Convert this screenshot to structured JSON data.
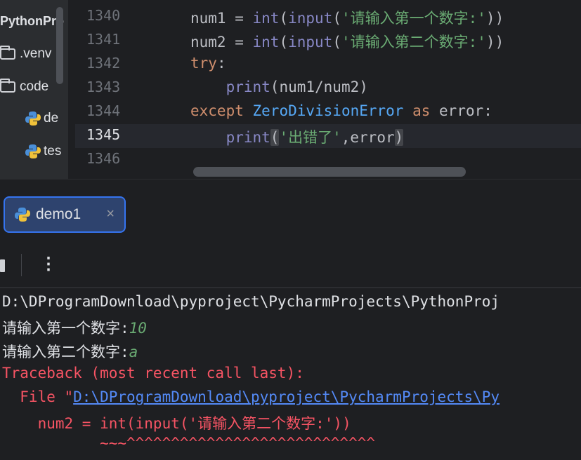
{
  "project": {
    "title": "PythonPro",
    "items": [
      {
        "label": ".venv",
        "icon": "folder-icon"
      },
      {
        "label": "code",
        "icon": "folder-icon"
      },
      {
        "label": "de",
        "icon": "python-file-icon"
      },
      {
        "label": "tes",
        "icon": "python-file-icon"
      }
    ]
  },
  "editor": {
    "line_numbers": [
      "1340",
      "1341",
      "1342",
      "1343",
      "1344",
      "1345",
      "1346"
    ],
    "current_line": "1345",
    "lines": [
      {
        "parts": [
          {
            "t": "num1 = ",
            "c": ""
          },
          {
            "t": "int",
            "c": "bi"
          },
          {
            "t": "(",
            "c": ""
          },
          {
            "t": "input",
            "c": "bi"
          },
          {
            "t": "(",
            "c": ""
          },
          {
            "t": "'请输入第一个数字:'",
            "c": "str"
          },
          {
            "t": "))",
            "c": ""
          }
        ]
      },
      {
        "parts": [
          {
            "t": "num2 = ",
            "c": ""
          },
          {
            "t": "int",
            "c": "bi"
          },
          {
            "t": "(",
            "c": ""
          },
          {
            "t": "input",
            "c": "bi"
          },
          {
            "t": "(",
            "c": ""
          },
          {
            "t": "'请输入第二个数字:'",
            "c": "str"
          },
          {
            "t": "))",
            "c": ""
          }
        ]
      },
      {
        "parts": [
          {
            "t": "try",
            "c": "kw"
          },
          {
            "t": ":",
            "c": ""
          }
        ]
      },
      {
        "parts": [
          {
            "t": "    ",
            "c": ""
          },
          {
            "t": "print",
            "c": "bi"
          },
          {
            "t": "(num1/num2)",
            "c": ""
          }
        ]
      },
      {
        "parts": [
          {
            "t": "except ",
            "c": "kw"
          },
          {
            "t": "ZeroDivisionError",
            "c": "cls"
          },
          {
            "t": " as ",
            "c": "kw"
          },
          {
            "t": "error:",
            "c": ""
          }
        ]
      },
      {
        "parts": [
          {
            "t": "    ",
            "c": ""
          },
          {
            "t": "print",
            "c": "bi"
          },
          {
            "t": "(",
            "c": "brace"
          },
          {
            "t": "'出错了'",
            "c": "str"
          },
          {
            "t": ",error",
            "c": ""
          },
          {
            "t": ")",
            "c": "brace"
          }
        ]
      },
      {
        "parts": []
      }
    ]
  },
  "run": {
    "tab_label": "demo1",
    "close_glyph": "×",
    "more_glyph": "⋮",
    "console": {
      "command": "D:\\DProgramDownload\\pyproject\\PycharmProjects\\PythonProj",
      "prompt1": "请输入第一个数字:",
      "input1": "10",
      "prompt2": "请输入第二个数字:",
      "input2": "a",
      "traceback": "Traceback (most recent call last):",
      "file_prefix": "  File \"",
      "file_link": "D:\\DProgramDownload\\pyproject\\PycharmProjects\\Py",
      "code_line": "    num2 = int(input('请输入第二个数字:'))",
      "caret_line": "           ~~~^^^^^^^^^^^^^^^^^^^^^^^^^^^^"
    }
  },
  "colors": {
    "background": "#1e1f22",
    "panel": "#2b2d30",
    "keyword": "#cf8e6d",
    "string": "#6aab73",
    "error": "#f75464",
    "link": "#548af7",
    "accent": "#3574f0"
  }
}
